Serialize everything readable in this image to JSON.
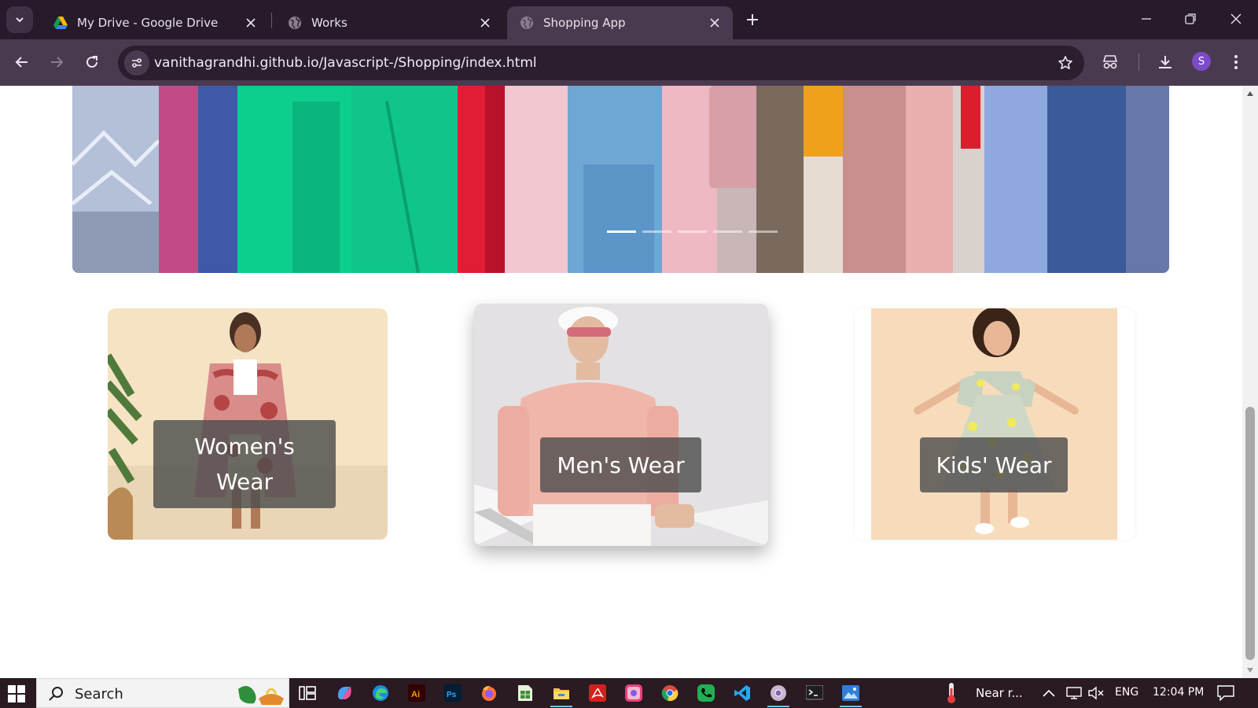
{
  "browser": {
    "tabs": [
      {
        "title": "My Drive - Google Drive",
        "icon": "google-drive-icon"
      },
      {
        "title": "Works",
        "icon": "globe-icon"
      },
      {
        "title": "Shopping App",
        "icon": "globe-icon",
        "active": true
      }
    ],
    "url": "vanithagrandhi.github.io/Javascript-/Shopping/index.html",
    "profile_initial": "S"
  },
  "page": {
    "carousel": {
      "slides": 5,
      "active_slide": 1
    },
    "categories": [
      {
        "label": "Women's Wear",
        "line1": "Women's",
        "line2": "Wear"
      },
      {
        "label": "Men's Wear"
      },
      {
        "label": "Kids' Wear"
      }
    ]
  },
  "taskbar": {
    "search_placeholder": "Search",
    "weather": "Near r...",
    "language": "ENG",
    "time": "12:04 PM"
  },
  "colors": {
    "titlebar": "#271a2b",
    "toolbar": "#4a3a4f",
    "profile": "#7d4bc5",
    "caption_bg": "#4e4e4e"
  }
}
